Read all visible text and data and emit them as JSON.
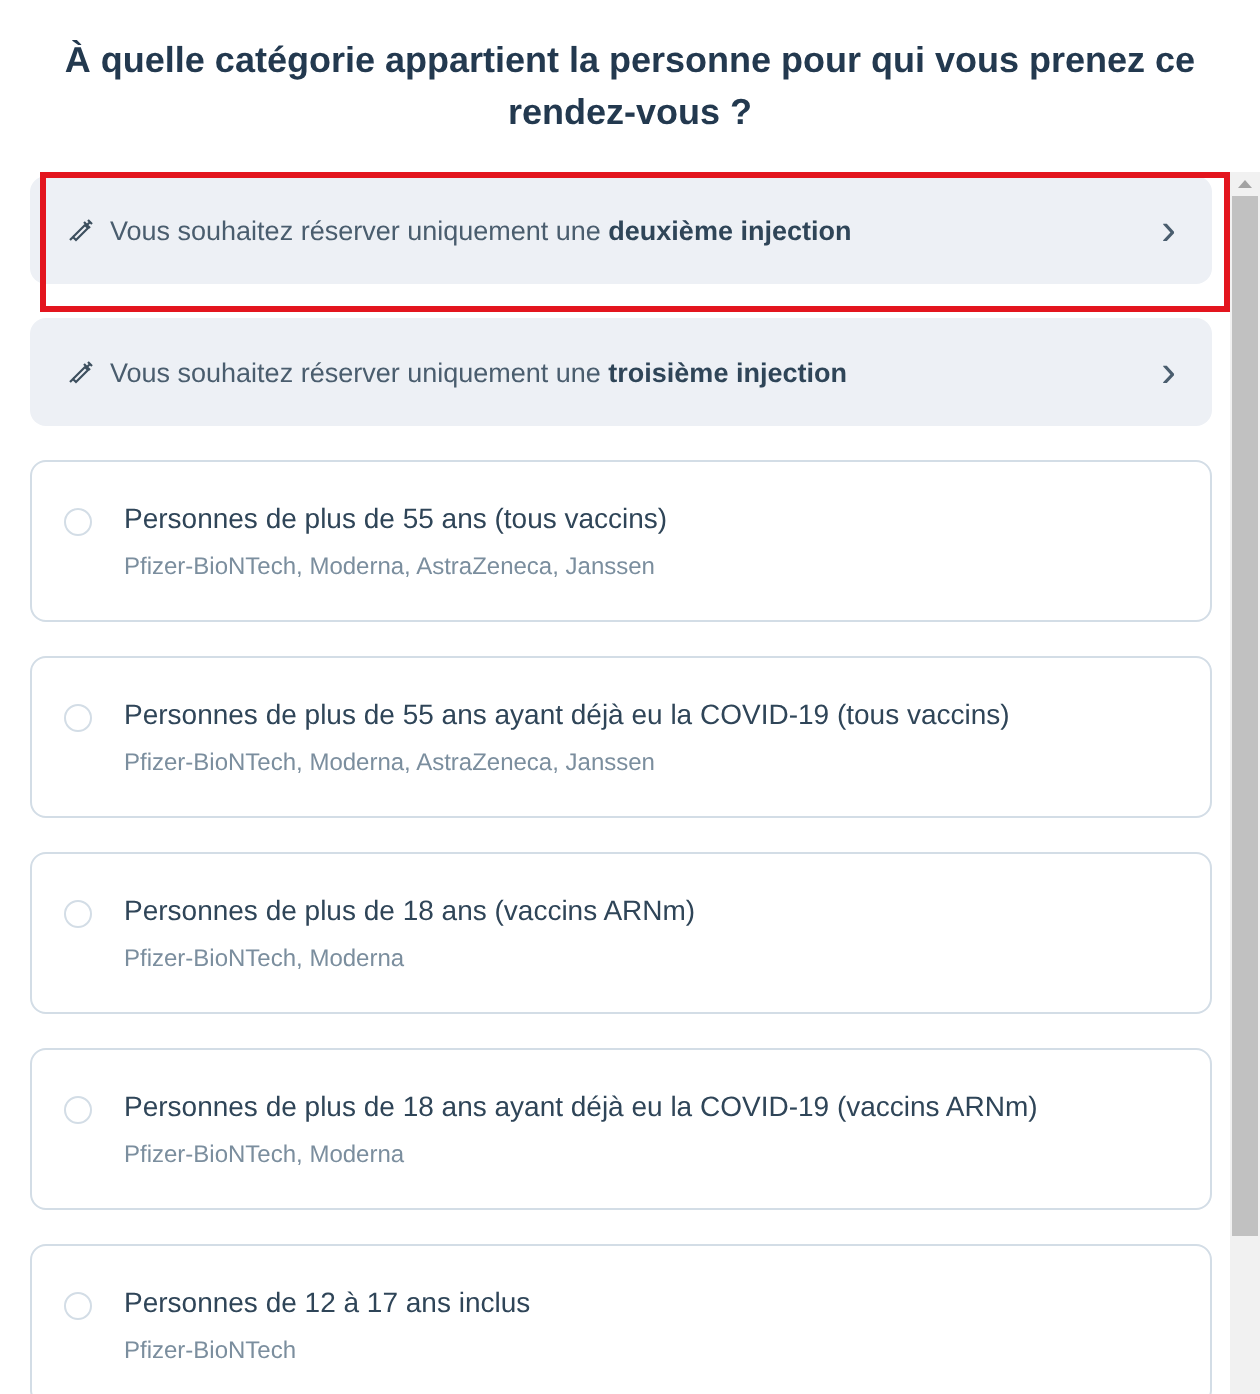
{
  "title": "À quelle catégorie appartient la personne pour qui vous prenez ce rendez-vous ?",
  "shortcuts": [
    {
      "text": "Vous souhaitez réserver uniquement une **deuxième injection**",
      "arrow": "›",
      "highlighted": true
    },
    {
      "text": "Vous souhaitez réserver uniquement une **troisième injection**",
      "arrow": "›",
      "highlighted": false
    }
  ],
  "options": [
    {
      "label": "Personnes de plus de 55 ans (tous vaccins)",
      "vaccines": "Pfizer-BioNTech, Moderna, AstraZeneca, Janssen",
      "selected": false
    },
    {
      "label": "Personnes de plus de 55 ans ayant déjà eu la COVID-19 (tous vaccins)",
      "vaccines": "Pfizer-BioNTech, Moderna, AstraZeneca, Janssen",
      "selected": false
    },
    {
      "label": "Personnes de plus de 18 ans (vaccins ARNm)",
      "vaccines": "Pfizer-BioNTech, Moderna",
      "selected": false
    },
    {
      "label": "Personnes de plus de 18 ans ayant déjà eu la COVID-19 (vaccins ARNm)",
      "vaccines": "Pfizer-BioNTech, Moderna",
      "selected": false
    },
    {
      "label": "Personnes de 12 à 17 ans inclus",
      "vaccines": "Pfizer-BioNTech",
      "selected": false
    }
  ]
}
